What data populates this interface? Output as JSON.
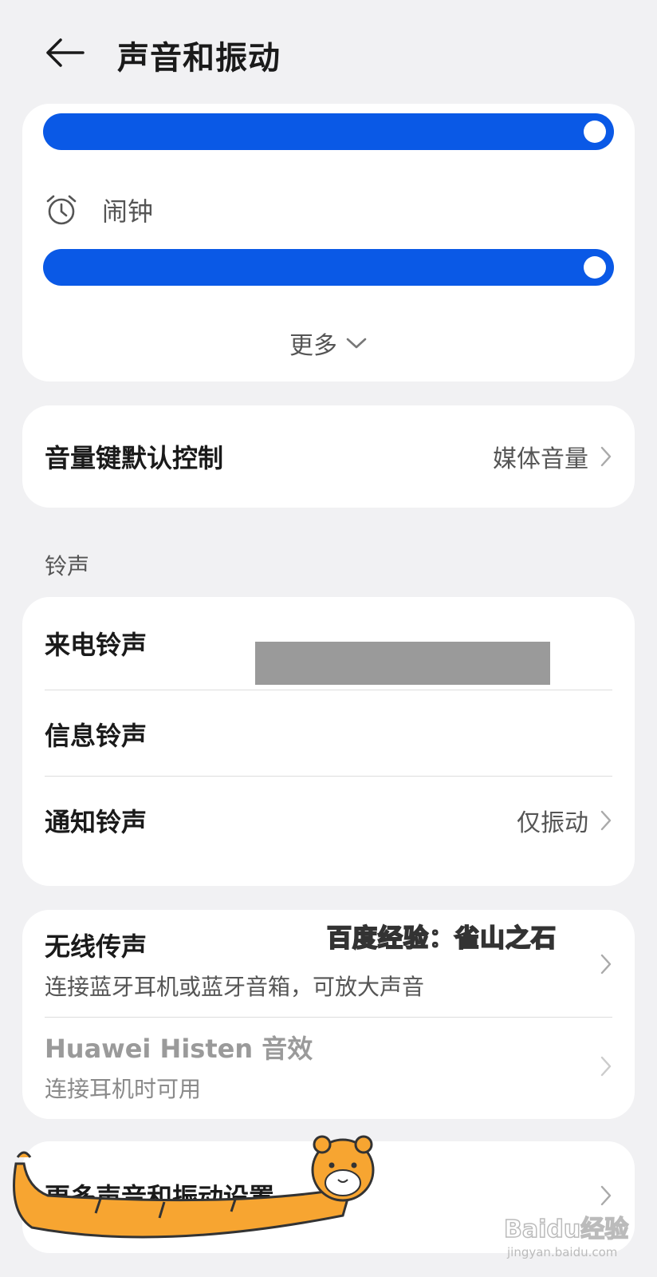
{
  "header": {
    "back_icon": "arrow-left-icon",
    "title": "声音和振动"
  },
  "volume": {
    "sliders": [
      {
        "name": "media",
        "level": 1.0
      },
      {
        "name": "alarm",
        "level": 1.0
      }
    ],
    "alarm_icon": "alarm-clock-icon",
    "alarm_label": "闹钟",
    "more_label": "更多"
  },
  "volume_key": {
    "title": "音量键默认控制",
    "value": "媒体音量"
  },
  "ringtones": {
    "section_label": "铃声",
    "items": [
      {
        "title": "来电铃声",
        "value": ""
      },
      {
        "title": "信息铃声",
        "value": ""
      },
      {
        "title": "通知铃声",
        "value": "仅振动"
      }
    ]
  },
  "audio": {
    "wireless": {
      "title": "无线传声",
      "subtitle": "连接蓝牙耳机或蓝牙音箱，可放大声音"
    },
    "histen": {
      "title": "Huawei Histen 音效",
      "subtitle": "连接耳机时可用"
    }
  },
  "more_settings": {
    "title": "更多声音和振动设置"
  },
  "watermark": {
    "text": "百度经验：雀山之石",
    "logo": "Baidu经验",
    "url": "jingyan.baidu.com"
  },
  "colors": {
    "accent": "#0a59e6",
    "background": "#f1f1f3",
    "card": "#ffffff"
  }
}
